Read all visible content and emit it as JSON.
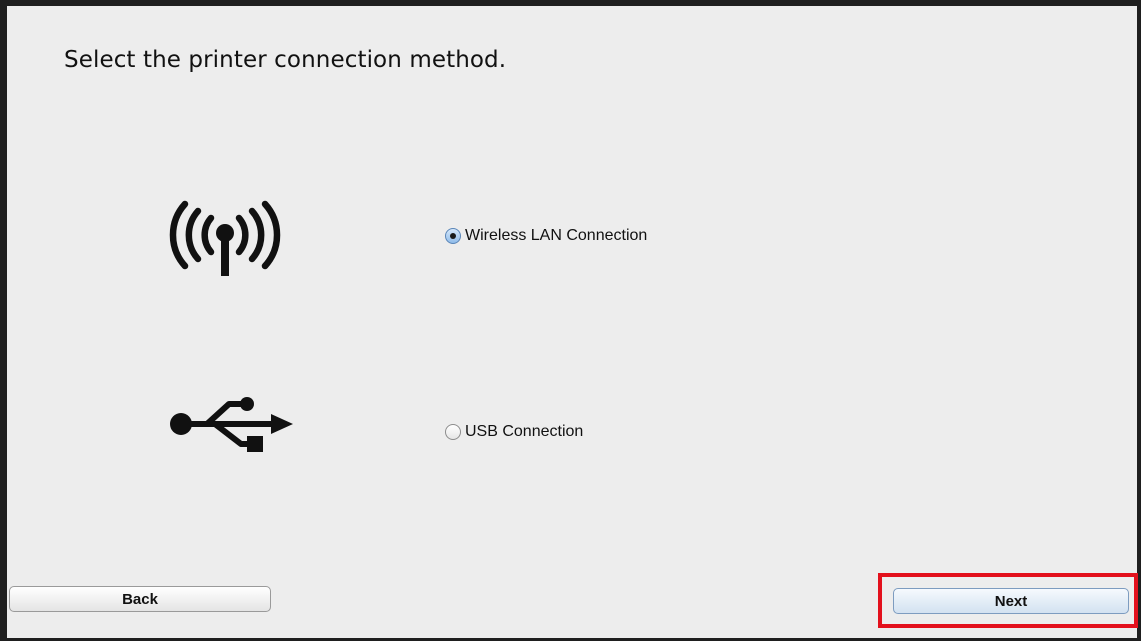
{
  "dialog": {
    "title": "Select the printer connection method."
  },
  "options": [
    {
      "label": "Wireless LAN Connection",
      "icon": "wireless-icon",
      "selected": true
    },
    {
      "label": "USB Connection",
      "icon": "usb-icon",
      "selected": false
    }
  ],
  "buttons": {
    "back_label": "Back",
    "next_label": "Next"
  },
  "colors": {
    "highlight": "#e3101c",
    "background": "#ededed",
    "radio_selected": "#8fbbe9"
  }
}
